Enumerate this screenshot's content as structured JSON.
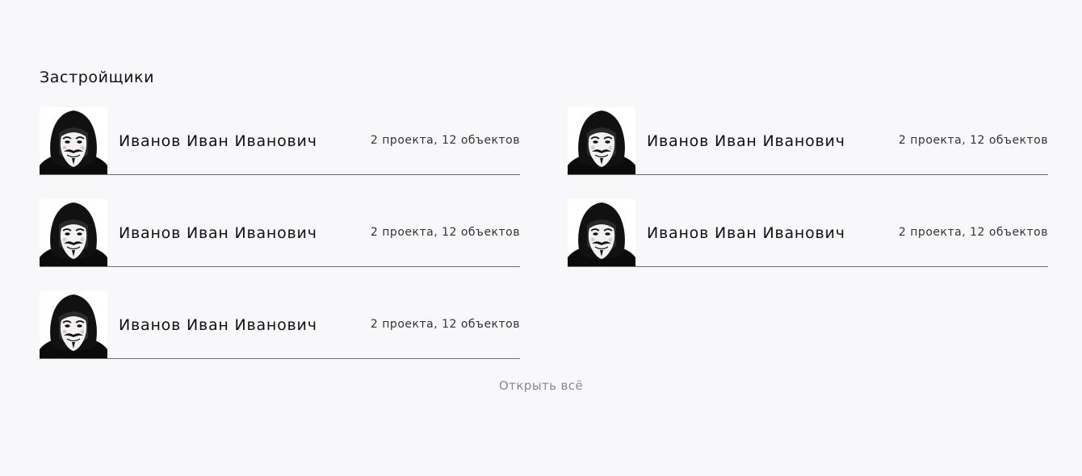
{
  "section": {
    "title": "Застройщики"
  },
  "developers": [
    {
      "name": "Иванов Иван Иванович",
      "stats": "2 проекта,  12 объектов",
      "avatar_icon": "guy-fawkes-mask-avatar"
    },
    {
      "name": "Иванов Иван Иванович",
      "stats": "2 проекта,  12 объектов",
      "avatar_icon": "guy-fawkes-mask-avatar"
    },
    {
      "name": "Иванов Иван Иванович",
      "stats": "2 проекта,  12 объектов",
      "avatar_icon": "guy-fawkes-mask-avatar"
    },
    {
      "name": "Иванов Иван Иванович",
      "stats": "2 проекта,  12 объектов",
      "avatar_icon": "guy-fawkes-mask-avatar"
    },
    {
      "name": "Иванов Иван Иванович",
      "stats": "2 проекта,  12 объектов",
      "avatar_icon": "guy-fawkes-mask-avatar"
    }
  ],
  "footer": {
    "open_all_label": "Открыть всё"
  },
  "colors": {
    "background": "#f8f7f9",
    "divider": "#6d6d6d",
    "link": "#8a8a8a"
  }
}
